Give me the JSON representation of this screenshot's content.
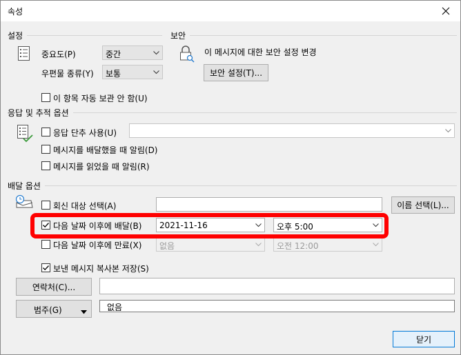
{
  "window": {
    "title": "속성"
  },
  "sections": {
    "settings": "설정",
    "security": "보안",
    "voting": "응답 및 추적 옵션",
    "delivery": "배달 옵션"
  },
  "settings": {
    "importance_label": "중요도(P)",
    "importance_value": "중간",
    "sensitivity_label": "우편물 종류(Y)",
    "sensitivity_value": "보통",
    "do_not_autoarchive": "이 항목 자동 보관 안 함(U)"
  },
  "security": {
    "description": "이 메시지에 대한 보안 설정 변경",
    "button": "보안 설정(T)..."
  },
  "voting": {
    "use_voting_buttons": "응답 단추 사용(U)",
    "voting_value": "",
    "request_delivery_receipt": "메시지를 배달했을 때 알림(D)",
    "request_read_receipt": "메시지를 읽었을 때 알림(R)"
  },
  "delivery": {
    "have_replies_sent_to": "회신 대상 선택(A)",
    "select_names_button": "이름 선택(L)...",
    "do_not_deliver_before": "다음 날짜 이후에 배달(B)",
    "deliver_date": "2021-11-16",
    "deliver_time": "오후 5:00",
    "expires_after": "다음 날짜 이후에 만료(X)",
    "expire_date": "없음",
    "expire_time": "오전 12:00",
    "save_copy": "보낸 메시지 복사본 저장(S)",
    "contacts_button": "연락처(C)...",
    "categories_button": "범주(G)",
    "categories_value": "없음"
  },
  "footer": {
    "close_button": "닫기"
  }
}
